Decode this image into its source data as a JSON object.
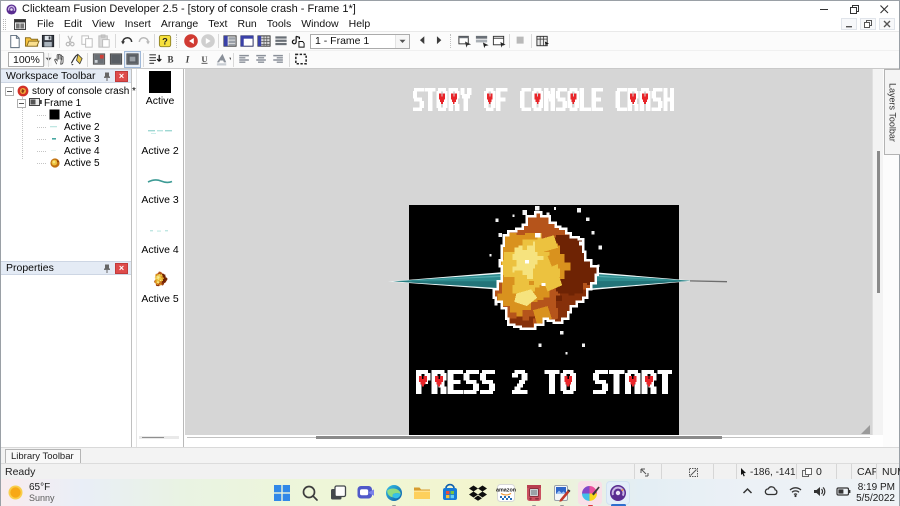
{
  "window": {
    "title": "Clickteam Fusion Developer 2.5 - [story of console crash - Frame 1*]",
    "controls": [
      "minimize",
      "restore",
      "close"
    ]
  },
  "menu": {
    "items": [
      "File",
      "Edit",
      "View",
      "Insert",
      "Arrange",
      "Text",
      "Run",
      "Tools",
      "Window",
      "Help"
    ]
  },
  "toolbar1": {
    "buttons": [
      "new",
      "open",
      "save",
      "|",
      "cut",
      "copy",
      "paste",
      "|",
      "undo",
      "redo",
      "|",
      "help",
      "::",
      "back",
      "forward",
      "|",
      "storyboard-editor",
      "frame-editor",
      "event-editor",
      "event-list-editor",
      "data-elements",
      "frame-combo",
      "previous-frame",
      "next-frame",
      "::",
      "run-application",
      "run-frame",
      "run-project",
      "|",
      "stop",
      "|",
      "step-through"
    ],
    "frame_selector": "1 - Frame 1"
  },
  "toolbar2": {
    "buttons": [
      "zoom-combo",
      "|",
      "hand",
      "edit-tool",
      "|",
      "grid-setup",
      "grid-show",
      "grid-snap",
      "|",
      "text-direction",
      "bold",
      "italic",
      "underline",
      "font-color",
      "|",
      "align-left",
      "align-center",
      "align-right",
      "|",
      "selection"
    ],
    "zoom_level": "100%",
    "pressed": "grid-snap"
  },
  "workspace_panel": {
    "title": "Workspace Toolbar",
    "tree": [
      {
        "label": "story of console crash *",
        "level": 0,
        "icon": "application",
        "expander": true
      },
      {
        "label": "Frame 1",
        "level": 1,
        "icon": "frame",
        "expander": true
      },
      {
        "label": "Active",
        "level": 2,
        "icon": "black-square",
        "expander": false
      },
      {
        "label": "Active 2",
        "level": 2,
        "icon": "teal-dash",
        "expander": false
      },
      {
        "label": "Active 3",
        "level": 2,
        "icon": "teal-dot",
        "expander": false
      },
      {
        "label": "Active 4",
        "level": 2,
        "icon": "blank",
        "expander": false
      },
      {
        "label": "Active 5",
        "level": 2,
        "icon": "explosion",
        "expander": false
      }
    ]
  },
  "properties_panel": {
    "title": "Properties"
  },
  "object_strip": {
    "items": [
      {
        "label": "Active",
        "thumb": "black-square"
      },
      {
        "label": "Active 2",
        "thumb": "teal-dashes"
      },
      {
        "label": "Active 3",
        "thumb": "teal-line"
      },
      {
        "label": "Active 4",
        "thumb": "teal-dots"
      },
      {
        "label": "Active 5",
        "thumb": "explosion"
      }
    ]
  },
  "canvas": {
    "title_text": "STORY OF CONSOLE CRASH",
    "press_text": "PRESS 2 TO START",
    "heart_letters": "ORAP",
    "colors": {
      "background": "#d6d6d6",
      "frame": "#000000",
      "text": "#ffffff",
      "heart": "#e8252a",
      "spike": "#2e8b8e",
      "explosion_dark": "#6e2304",
      "explosion_orange": "#b5541b",
      "explosion_amber": "#d9921e",
      "explosion_gold": "#ecc23f",
      "explosion_pale": "#f6e37e"
    }
  },
  "layers_tab": {
    "label": "Layers Toolbar"
  },
  "library_bar": {
    "label": "Library Toolbar"
  },
  "statusbar": {
    "ready": "Ready",
    "coordinates": "-186, -141",
    "counter": "0",
    "cap": "CAP",
    "num": "NUM"
  },
  "taskbar": {
    "weather": {
      "temp": "65°F",
      "condition": "Sunny"
    },
    "icons": [
      {
        "name": "windows"
      },
      {
        "name": "search"
      },
      {
        "name": "task-view"
      },
      {
        "name": "chat"
      },
      {
        "name": "edge",
        "dot": true
      },
      {
        "name": "explorer"
      },
      {
        "name": "store"
      },
      {
        "name": "dropbox"
      },
      {
        "name": "amazon"
      },
      {
        "name": "emulator",
        "dot": true
      },
      {
        "name": "image-editor",
        "dot": true
      },
      {
        "name": "art-app",
        "dot": "red",
        "bg": "pink"
      },
      {
        "name": "fusion",
        "active": true,
        "bg": "blue"
      }
    ],
    "tray_icons": [
      "chevron-up",
      "cloud",
      "wifi",
      "volume",
      "battery"
    ],
    "clock": {
      "time": "8:19 PM",
      "date": "5/5/2022"
    }
  }
}
